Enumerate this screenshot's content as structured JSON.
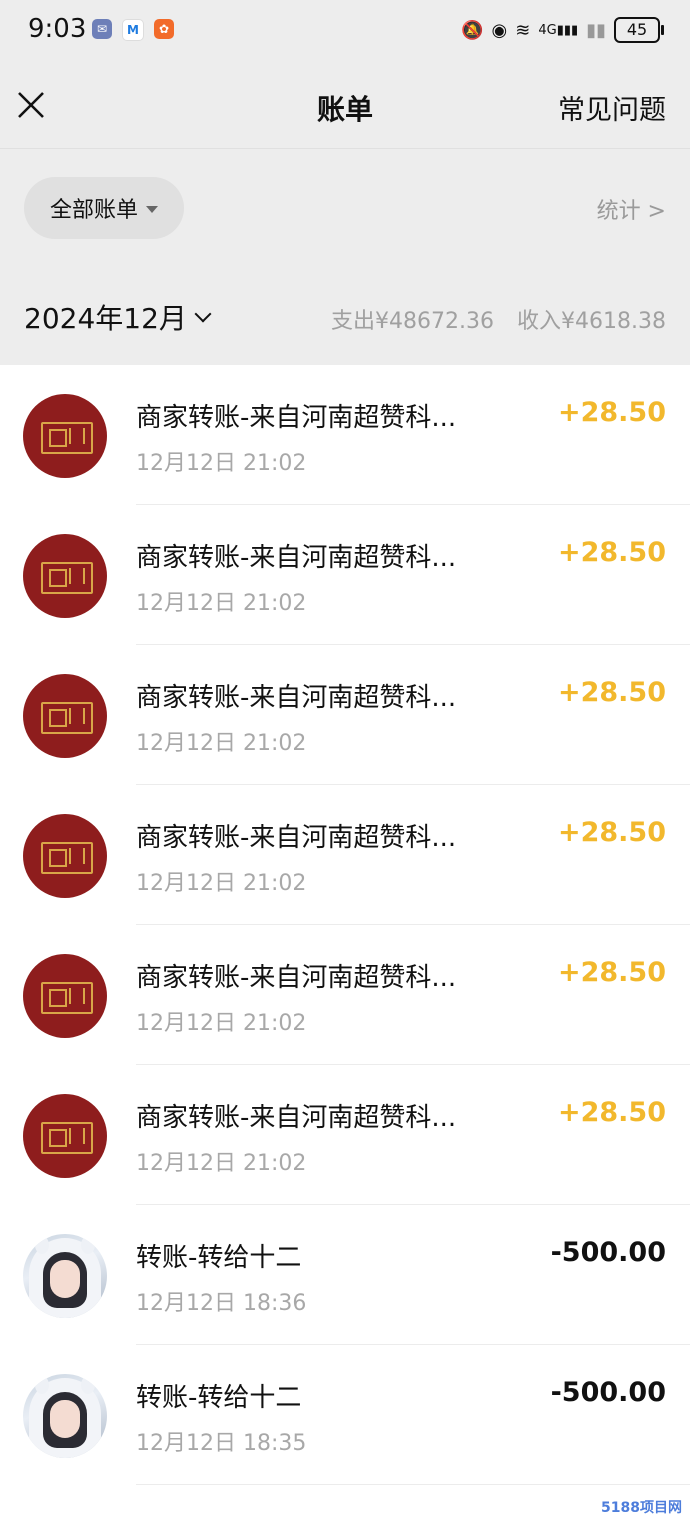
{
  "status_bar": {
    "time": "9:03",
    "battery": "45",
    "signal_label": "4G"
  },
  "nav": {
    "title": "账单",
    "faq": "常见问题"
  },
  "filter": {
    "label": "全部账单",
    "stats": "统计 >"
  },
  "month": {
    "label": "2024年12月",
    "expense": "支出¥48672.36",
    "income": "收入¥4618.38"
  },
  "colors": {
    "income_amount": "#f2b82d",
    "merchant_avatar_bg": "#8e1d1d",
    "header_bg": "#ededed"
  },
  "transactions": [
    {
      "title": "商家转账-来自河南超赞科...",
      "time": "12月12日 21:02",
      "amount": "+28.50",
      "type": "income",
      "avatar": "merchant-logo"
    },
    {
      "title": "商家转账-来自河南超赞科...",
      "time": "12月12日 21:02",
      "amount": "+28.50",
      "type": "income",
      "avatar": "merchant-logo"
    },
    {
      "title": "商家转账-来自河南超赞科...",
      "time": "12月12日 21:02",
      "amount": "+28.50",
      "type": "income",
      "avatar": "merchant-logo"
    },
    {
      "title": "商家转账-来自河南超赞科...",
      "time": "12月12日 21:02",
      "amount": "+28.50",
      "type": "income",
      "avatar": "merchant-logo"
    },
    {
      "title": "商家转账-来自河南超赞科...",
      "time": "12月12日 21:02",
      "amount": "+28.50",
      "type": "income",
      "avatar": "merchant-logo"
    },
    {
      "title": "商家转账-来自河南超赞科...",
      "time": "12月12日 21:02",
      "amount": "+28.50",
      "type": "income",
      "avatar": "merchant-logo"
    },
    {
      "title": "转账-转给十二",
      "time": "12月12日 18:36",
      "amount": "-500.00",
      "type": "expense",
      "avatar": "user-photo"
    },
    {
      "title": "转账-转给十二",
      "time": "12月12日 18:35",
      "amount": "-500.00",
      "type": "expense",
      "avatar": "user-photo"
    }
  ],
  "watermark": "5188项目网"
}
